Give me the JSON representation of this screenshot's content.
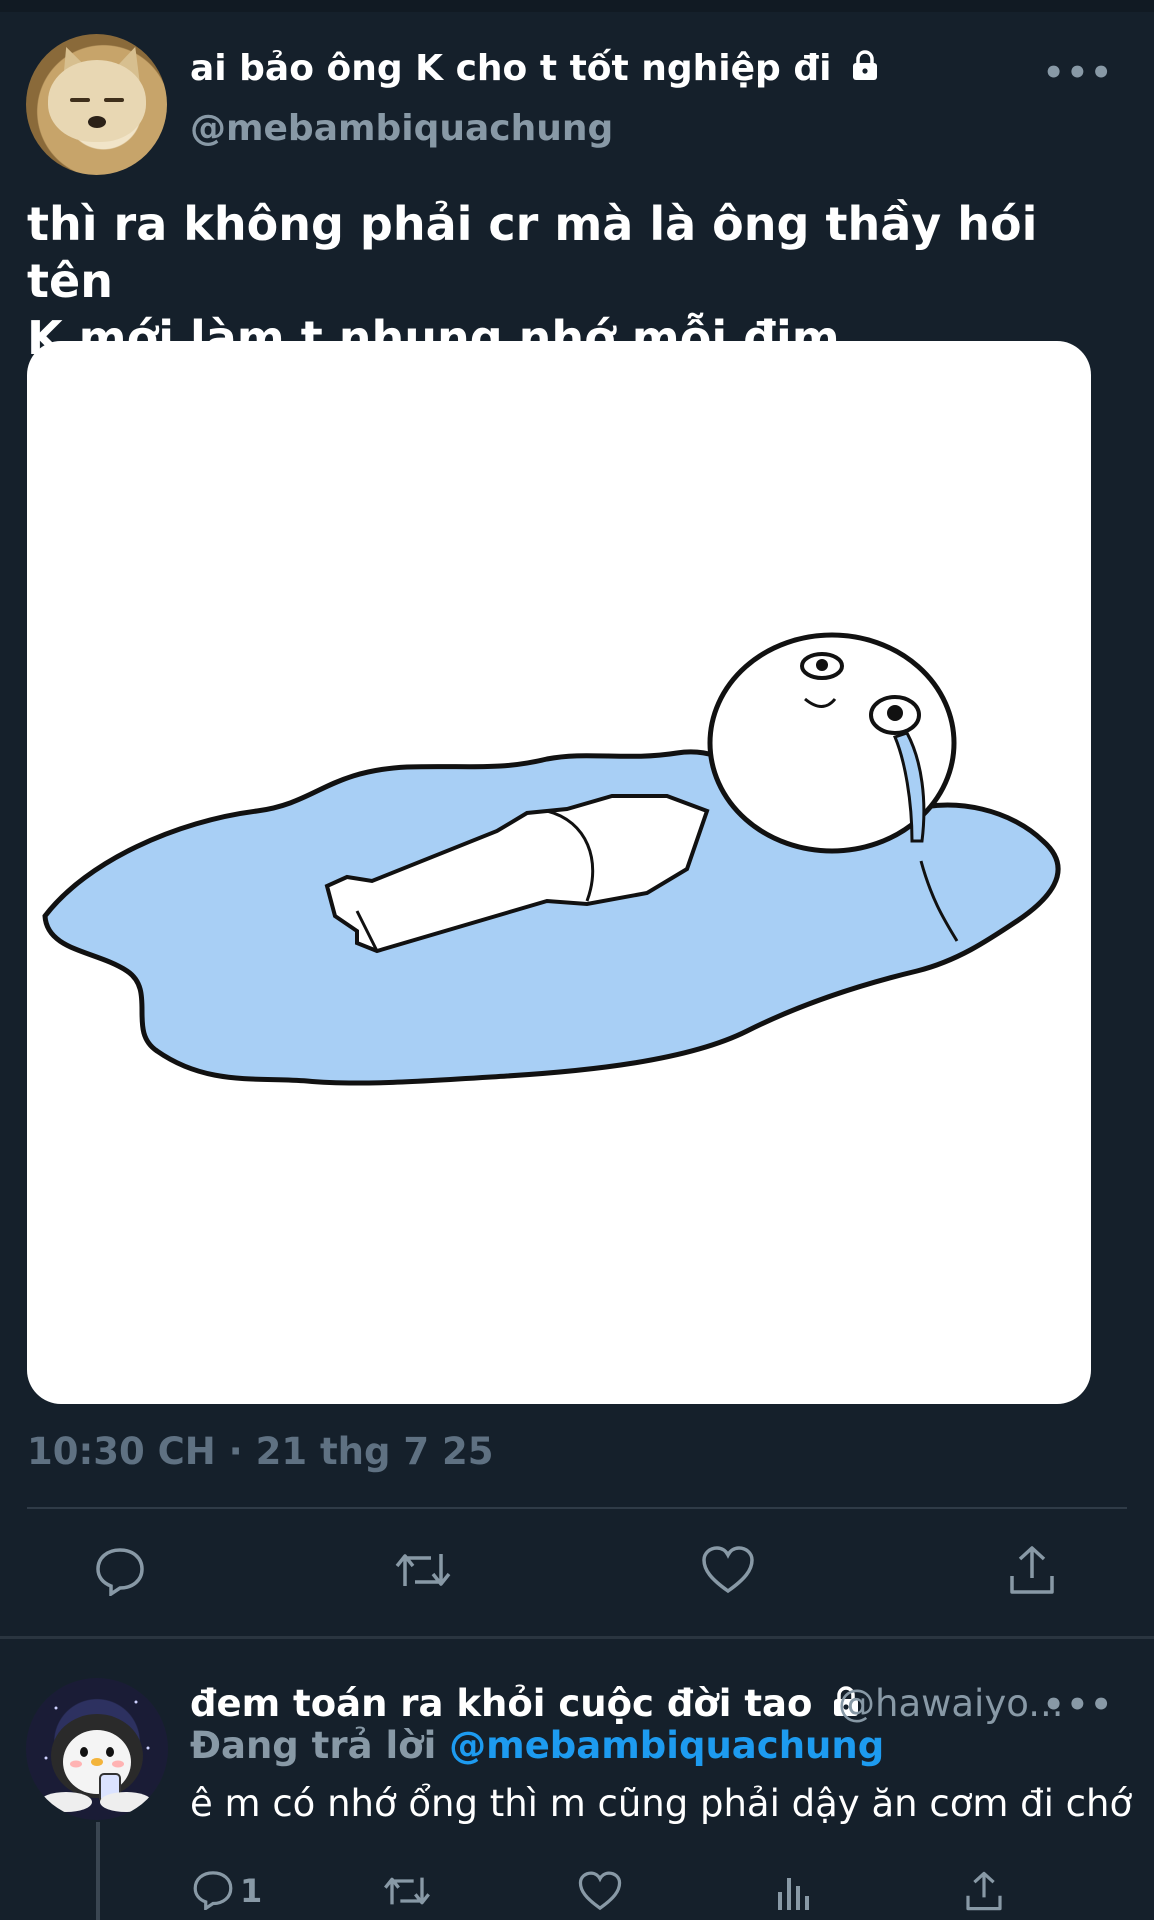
{
  "tweet": {
    "display_name": "ai bảo ông K cho t tốt nghiệp đi",
    "handle": "@mebambiquachung",
    "text_line1": "thì ra không phải cr mà là ông thầy hói tên",
    "text_line2": "K mới làm t nhung nhớ mỗi đim",
    "timestamp": "10:30 CH · 21 thg 7 25",
    "actions": [
      "reply-icon",
      "retweet-icon",
      "like-icon",
      "share-icon"
    ]
  },
  "reply": {
    "display_name": "đem toán ra khỏi cuộc đời tao",
    "handle": "@hawaiyo...",
    "replying_prefix": "Đang trả lời",
    "replying_to": "@mebambiquachung",
    "text": "ê m có nhớ ổng thì m cũng phải dậy ăn cơm đi chớ",
    "reply_count": "1",
    "actions": [
      "reply-icon",
      "retweet-icon",
      "like-icon",
      "analytics-icon",
      "share-icon"
    ]
  },
  "colors": {
    "background": "#15202b",
    "secondary_text": "#8899a6",
    "mention": "#1d9bf0",
    "puddle": "#a8cff5"
  }
}
